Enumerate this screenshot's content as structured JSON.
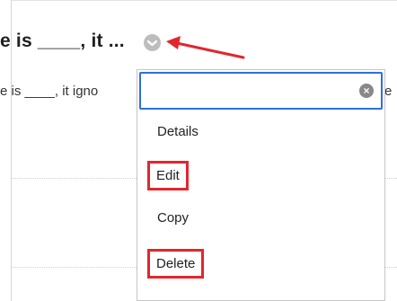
{
  "question": {
    "title": "e is ____, it ...",
    "text": "e is ____, it igno",
    "edge_text": "e"
  },
  "menu": {
    "search_placeholder": "",
    "items": [
      {
        "label": "Details"
      },
      {
        "label": "Edit"
      },
      {
        "label": "Copy"
      },
      {
        "label": "Delete"
      }
    ]
  },
  "colors": {
    "highlight": "#e3262d",
    "focus": "#2f6fdc"
  }
}
